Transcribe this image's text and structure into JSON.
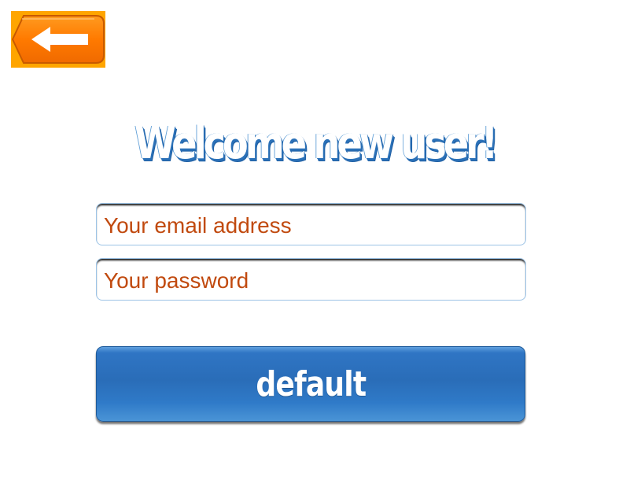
{
  "header": {
    "back_icon": "left-arrow-icon"
  },
  "title": "Welcome new user!",
  "form": {
    "email_placeholder": "Your email address",
    "password_placeholder": "Your password"
  },
  "main_button": {
    "label": "default"
  },
  "colors": {
    "back_button_bg": "#ffa500",
    "back_button_fill": "#ff7a00",
    "title_shadow": "#2b71b8",
    "placeholder_text": "#c14a0f",
    "button_blue": "#2a6db8"
  }
}
